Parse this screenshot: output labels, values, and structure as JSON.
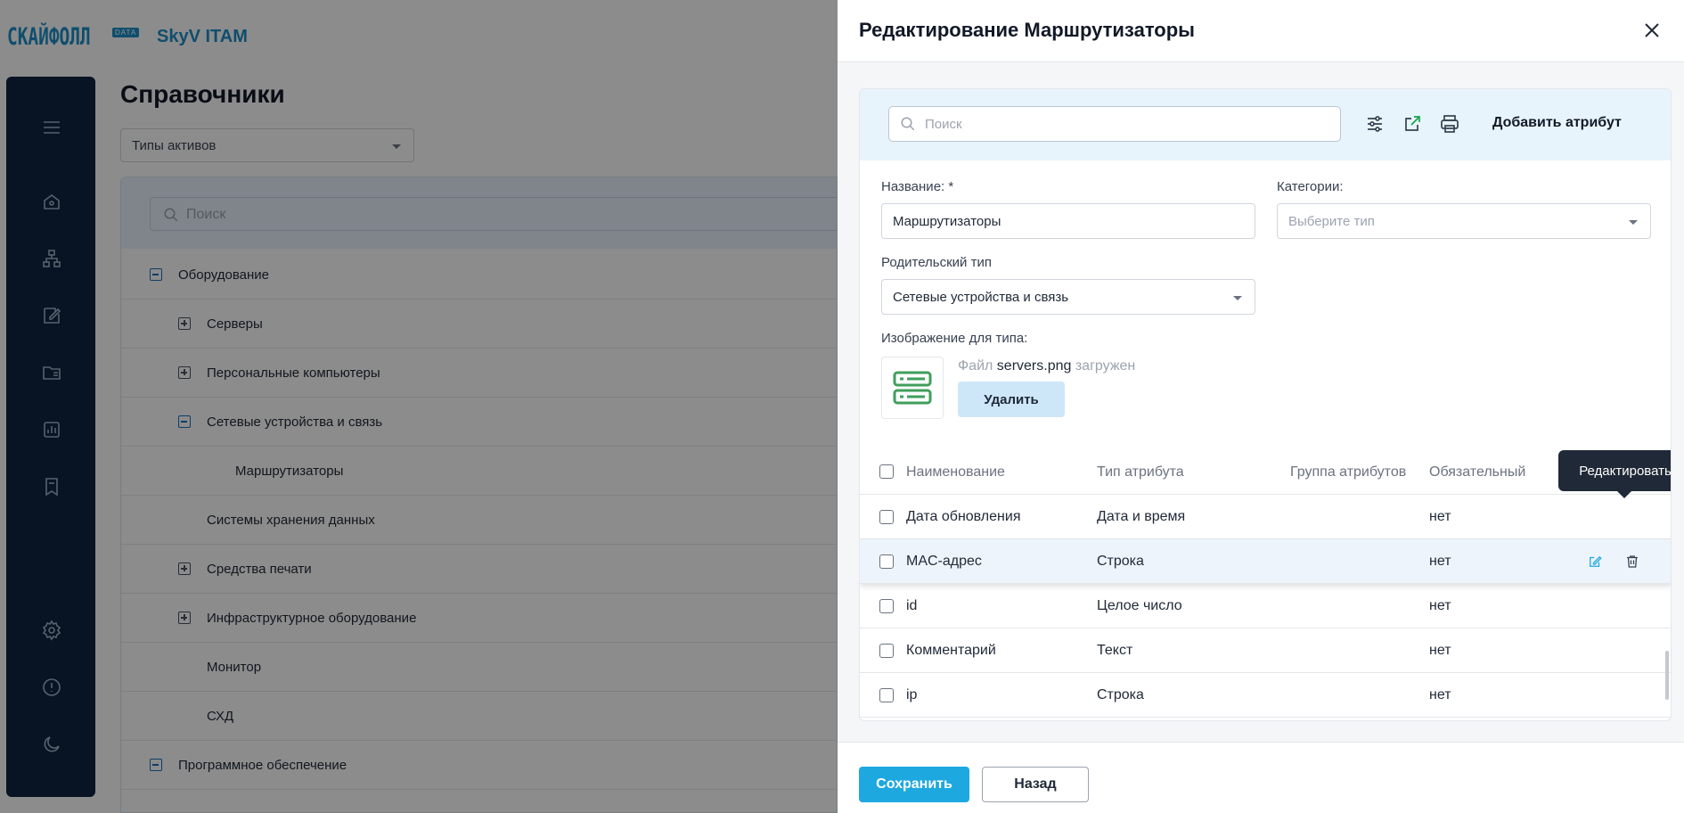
{
  "header": {
    "logo_text": "СКАЙФОЛЛ",
    "logo_badge": "DATA",
    "app_name": "SkyV ITAM"
  },
  "sidebar": {
    "items": [
      {
        "icon": "menu-icon"
      },
      {
        "icon": "home-icon"
      },
      {
        "icon": "network-icon"
      },
      {
        "icon": "edit-document-icon"
      },
      {
        "icon": "folder-icon"
      },
      {
        "icon": "chart-icon"
      },
      {
        "icon": "bookmark-icon"
      },
      {
        "icon": "gear-icon"
      },
      {
        "icon": "info-icon"
      },
      {
        "icon": "moon-icon"
      }
    ]
  },
  "main": {
    "title": "Справочники",
    "type_select": "Типы активов",
    "search_placeholder": "Поиск",
    "tree": [
      {
        "label": "Оборудование",
        "toggle": "minus",
        "level": 0
      },
      {
        "label": "Серверы",
        "toggle": "plus",
        "level": 1
      },
      {
        "label": "Персональные компьютеры",
        "toggle": "plus",
        "level": 1
      },
      {
        "label": "Сетевые устройства и связь",
        "toggle": "minus",
        "level": 1
      },
      {
        "label": "Маршрутизаторы",
        "toggle": "none",
        "level": 2
      },
      {
        "label": "Системы хранения данных",
        "toggle": "none",
        "level": 1
      },
      {
        "label": "Средства печати",
        "toggle": "plus",
        "level": 1
      },
      {
        "label": "Инфраструктурное оборудование",
        "toggle": "plus",
        "level": 1
      },
      {
        "label": "Монитор",
        "toggle": "none",
        "level": 1
      },
      {
        "label": "СХД",
        "toggle": "none",
        "level": 1
      },
      {
        "label": "Программное обеспечение",
        "toggle": "minus",
        "level": 0
      }
    ]
  },
  "drawer": {
    "title": "Редактирование Маршрутизаторы",
    "search_placeholder": "Поиск",
    "add_attribute": "Добавить атрибут",
    "name_label": "Название: *",
    "name_value": "Маршрутизаторы",
    "categories_label": "Категории:",
    "categories_placeholder": "Выберите тип",
    "parent_label": "Родительский тип",
    "parent_value": "Сетевые устройства и связь",
    "image_label": "Изображение для типа:",
    "file_prefix": "Файл",
    "file_name": "servers.png",
    "file_suffix": "загружен",
    "delete_label": "Удалить",
    "table": {
      "columns": [
        "Наименование",
        "Тип атрибута",
        "Группа атрибутов",
        "Обязательный"
      ],
      "rows": [
        {
          "name": "Дата обновления",
          "type": "Дата и время",
          "group": "",
          "required": "нет"
        },
        {
          "name": "MAC-адрес",
          "type": "Строка",
          "group": "",
          "required": "нет"
        },
        {
          "name": "id",
          "type": "Целое число",
          "group": "",
          "required": "нет"
        },
        {
          "name": "Комментарий",
          "type": "Текст",
          "group": "",
          "required": "нет"
        },
        {
          "name": "ip",
          "type": "Строка",
          "group": "",
          "required": "нет"
        }
      ]
    },
    "tooltip": "Редактировать",
    "save_label": "Сохранить",
    "back_label": "Назад"
  },
  "colors": {
    "accent": "#1ea8e0",
    "brand": "#1d8fc7",
    "sidebar": "#0f2440"
  }
}
